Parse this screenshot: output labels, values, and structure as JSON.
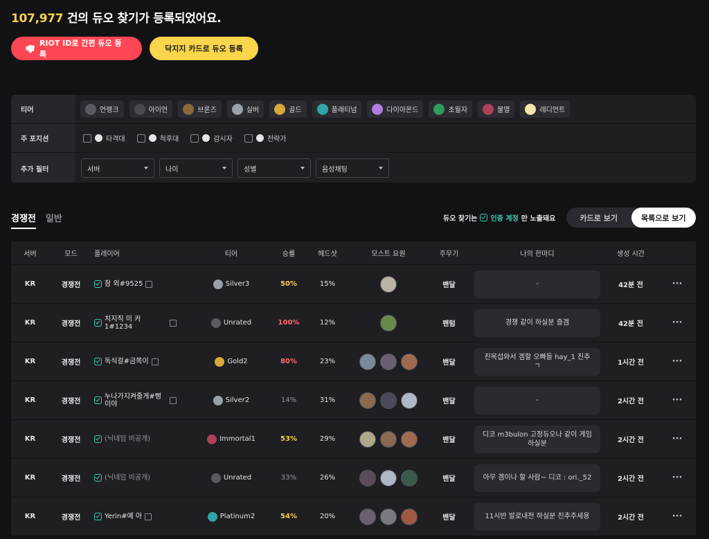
{
  "headline": {
    "count": "107,977",
    "text": " 건의 듀오 찾기가 등록되었어요."
  },
  "buttons": {
    "riot": "RIOT ID로 간편 듀오 등록",
    "card": "닥지지 카드로 듀오 등록"
  },
  "filters": {
    "tier_label": "티어",
    "tiers": [
      {
        "label": "언랭크",
        "color": "#5a5a62"
      },
      {
        "label": "아이언",
        "color": "#4a4a50"
      },
      {
        "label": "브론즈",
        "color": "#8a6a3a"
      },
      {
        "label": "실버",
        "color": "#9aa0a8"
      },
      {
        "label": "골드",
        "color": "#d9a83a"
      },
      {
        "label": "플래티넘",
        "color": "#2fa6a6"
      },
      {
        "label": "다이아몬드",
        "color": "#b07ce0"
      },
      {
        "label": "초월자",
        "color": "#2f9a5e"
      },
      {
        "label": "불멸",
        "color": "#b0405a"
      },
      {
        "label": "레디언트",
        "color": "#f4e6a8"
      }
    ],
    "position_label": "주 포지션",
    "positions": [
      "타격대",
      "척후대",
      "감시자",
      "전략가"
    ],
    "extra_label": "추가 필터",
    "selects": [
      "서버",
      "나이",
      "성별",
      "음성채팅"
    ]
  },
  "tabs": {
    "competitive": "경쟁전",
    "normal": "일반"
  },
  "notice": {
    "prefix": "듀오 찾기는",
    "verified": "인증 계정",
    "suffix": "만 노출돼요"
  },
  "view_toggle": {
    "card": "카드로 보기",
    "list": "목록으로 보기"
  },
  "table": {
    "headers": [
      "서버",
      "모드",
      "플레이어",
      "티어",
      "승률",
      "헤드샷",
      "모스트 요원",
      "주무기",
      "나의 한마디",
      "생성 시간"
    ],
    "rows": [
      {
        "server": "KR",
        "mode": "경쟁전",
        "player": "참 외#9525",
        "tier": "Silver3",
        "win_rate": "50%",
        "headshot": "15%",
        "main": "밴달",
        "message": "-",
        "time": "42분 전"
      },
      {
        "server": "KR",
        "mode": "경쟁전",
        "player": "치지직 미 카1#1234",
        "tier": "Unrated",
        "win_rate": "100%",
        "headshot": "12%",
        "main": "팬텀",
        "message": "경쟁 같이 하실분 즐겜",
        "time": "42분 전"
      },
      {
        "server": "KR",
        "mode": "경쟁전",
        "player": "독식걸#금쪽이",
        "tier": "Gold2",
        "win_rate": "80%",
        "headshot": "23%",
        "main": "밴달",
        "message": "친목섭와서 겜할 오빠들 hay_1 친추ㄱ",
        "time": "1시간 전"
      },
      {
        "server": "KR",
        "mode": "경쟁전",
        "player": "누나가지켜줄게#뻥이야",
        "tier": "Silver2",
        "win_rate": "14%",
        "headshot": "31%",
        "main": "밴달",
        "message": "-",
        "time": "2시간 전"
      },
      {
        "server": "KR",
        "mode": "경쟁전",
        "player": "(닉네임 비공개)",
        "tier": "Immortal1",
        "win_rate": "53%",
        "headshot": "29%",
        "main": "밴달",
        "message": "디코 m3bulon 고정듀오나 같이 게임하실분",
        "time": "2시간 전"
      },
      {
        "server": "KR",
        "mode": "경쟁전",
        "player": "(닉네임 비공개)",
        "tier": "Unrated",
        "win_rate": "33%",
        "headshot": "26%",
        "main": "밴달",
        "message": "아무 겜이나 할 사람~ 디코 : ori._52",
        "time": "2시간 전"
      },
      {
        "server": "KR",
        "mode": "경쟁전",
        "player": "Yerin#예 아",
        "tier": "Platinum2",
        "win_rate": "54%",
        "headshot": "20%",
        "main": "밴달",
        "message": "11시반 발로내전 하실분 친추주세용",
        "time": "2시간 전"
      }
    ]
  }
}
